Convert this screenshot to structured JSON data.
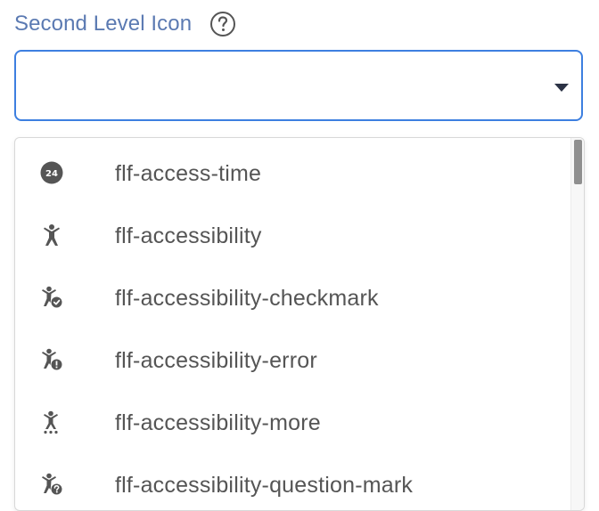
{
  "field": {
    "label": "Second Level Icon",
    "help_icon": "question-circle-icon",
    "selected_value": ""
  },
  "dropdown": {
    "options": [
      {
        "label": "flf-access-time",
        "icon": "access-time-icon"
      },
      {
        "label": "flf-accessibility",
        "icon": "accessibility-icon"
      },
      {
        "label": "flf-accessibility-checkmark",
        "icon": "accessibility-checkmark-icon"
      },
      {
        "label": "flf-accessibility-error",
        "icon": "accessibility-error-icon"
      },
      {
        "label": "flf-accessibility-more",
        "icon": "accessibility-more-icon"
      },
      {
        "label": "flf-accessibility-question-mark",
        "icon": "accessibility-question-mark-icon"
      }
    ]
  },
  "colors": {
    "label": "#5b7ab2",
    "focus_border": "#3d7fe0",
    "icon": "#555555",
    "option_text": "#555555"
  }
}
